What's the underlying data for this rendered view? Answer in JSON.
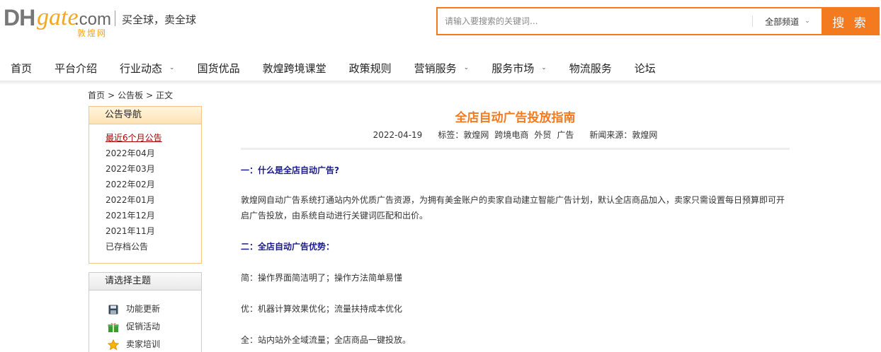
{
  "header": {
    "logo": {
      "dh": "DH",
      "gate": "gate",
      "com": ".com",
      "cn": "敦煌网"
    },
    "slogan": "买全球，卖全球",
    "search": {
      "placeholder": "请输入要搜索的关键词...",
      "channel": "全部频道",
      "button": "搜 索"
    }
  },
  "nav": {
    "items": [
      {
        "label": "首页",
        "dropdown": false
      },
      {
        "label": "平台介绍",
        "dropdown": false
      },
      {
        "label": "行业动态",
        "dropdown": true
      },
      {
        "label": "国货优品",
        "dropdown": false
      },
      {
        "label": "敦煌跨境课堂",
        "dropdown": false
      },
      {
        "label": "政策规则",
        "dropdown": false
      },
      {
        "label": "营销服务",
        "dropdown": true
      },
      {
        "label": "服务市场",
        "dropdown": true
      },
      {
        "label": "物流服务",
        "dropdown": false
      },
      {
        "label": "论坛",
        "dropdown": false
      }
    ]
  },
  "breadcrumb": {
    "home": "首页",
    "board": "公告板",
    "current": "正文",
    "sep": ">"
  },
  "sidebar": {
    "nav_title": "公告导航",
    "months": [
      "最近6个月公告",
      "2022年04月",
      "2022年03月",
      "2022年02月",
      "2022年01月",
      "2021年12月",
      "2021年11月",
      "已存档公告"
    ],
    "topic_title": "请选择主题",
    "topics": [
      {
        "label": "功能更新",
        "icon": "save-icon"
      },
      {
        "label": "促销活动",
        "icon": "gift-icon"
      },
      {
        "label": "卖家培训",
        "icon": "star-icon"
      }
    ]
  },
  "article": {
    "title": "全店自动广告投放指南",
    "date": "2022-04-19",
    "tags_label": "标签：",
    "tags": [
      "敦煌网",
      "跨境电商",
      "外贸",
      "广告"
    ],
    "source": "新闻来源：敦煌网",
    "sec1": "一：什么是全店自动广告?",
    "p1": "敦煌网自动广告系统打通站内外优质广告资源，为拥有美金账户的卖家自动建立智能广告计划，默认全店商品加入，卖家只需设置每日预算即可开启广告投放，由系统自动进行关键词匹配和出价。",
    "sec2": "二：全店自动广告优势：",
    "p2": "简：操作界面简洁明了；操作方法简单易懂",
    "p3": "优：机器计算效果优化；流量扶持成本优化",
    "p4": "全：站内站外全域流量；全店商品一键投放。"
  },
  "colors": {
    "accent": "#f47a20",
    "section": "#1a1a8c",
    "active_link": "#aa0000"
  }
}
